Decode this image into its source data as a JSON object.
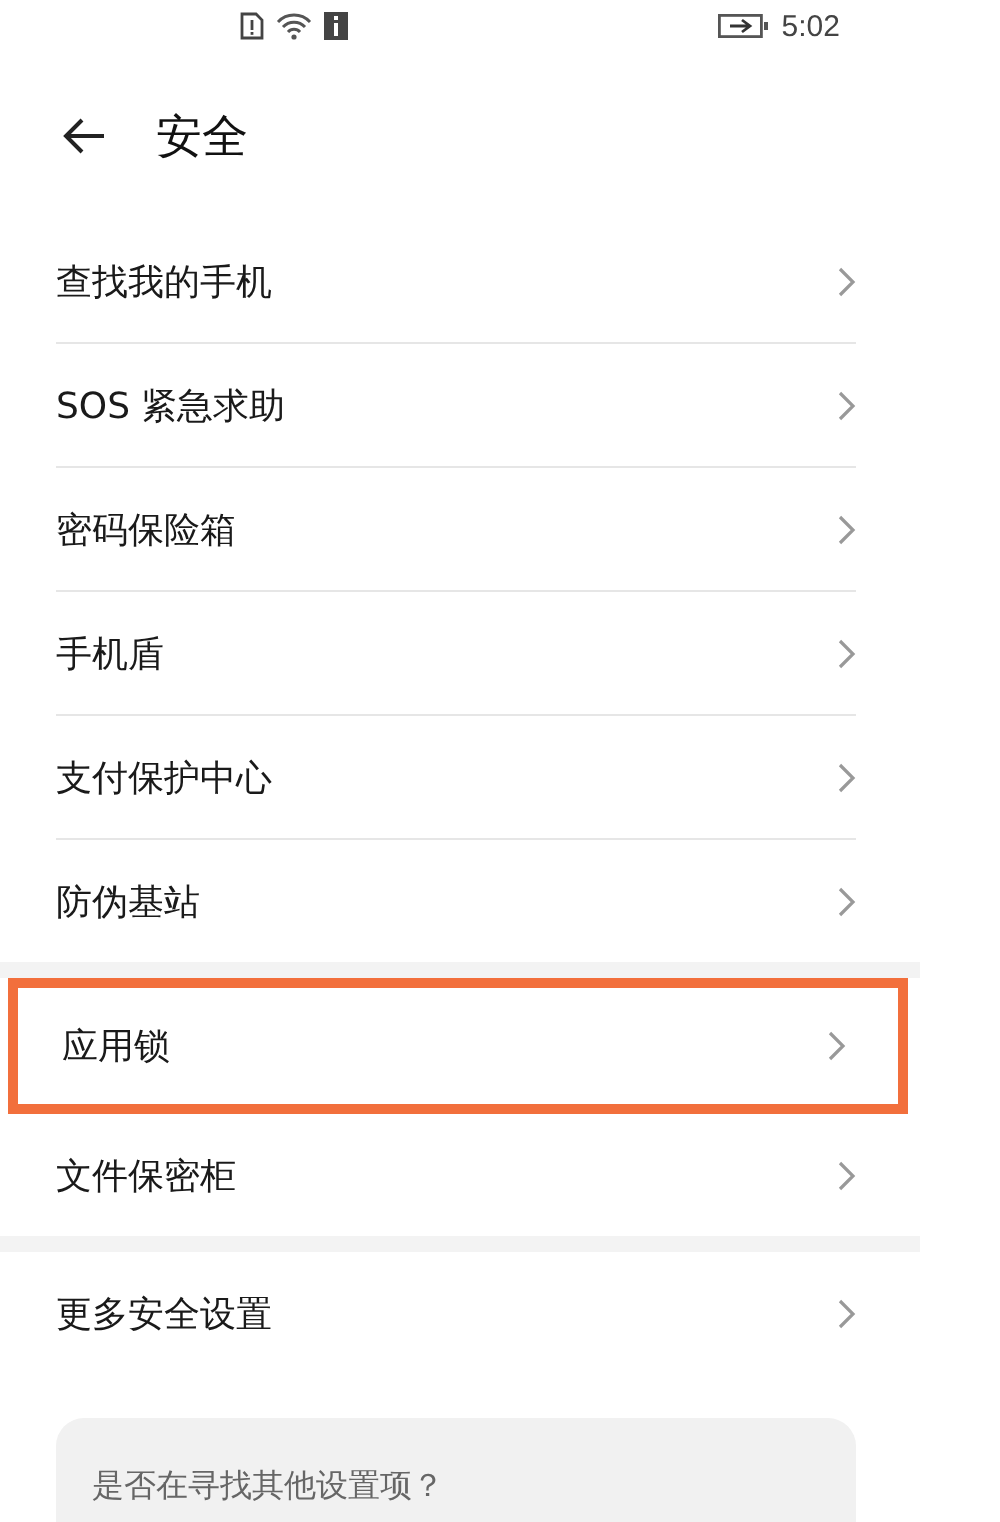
{
  "status_bar": {
    "time": "5:02"
  },
  "header": {
    "title": "安全"
  },
  "groups": [
    {
      "items": [
        {
          "label": "查找我的手机",
          "highlighted": false
        },
        {
          "label": "SOS 紧急求助",
          "highlighted": false
        },
        {
          "label": "密码保险箱",
          "highlighted": false
        },
        {
          "label": "手机盾",
          "highlighted": false
        },
        {
          "label": "支付保护中心",
          "highlighted": false
        },
        {
          "label": "防伪基站",
          "highlighted": false
        }
      ]
    },
    {
      "items": [
        {
          "label": "应用锁",
          "highlighted": true
        },
        {
          "label": "文件保密柜",
          "highlighted": false
        }
      ]
    },
    {
      "items": [
        {
          "label": "更多安全设置",
          "highlighted": false
        }
      ]
    }
  ],
  "suggestion_card": {
    "question": "是否在寻找其他设置项？"
  }
}
